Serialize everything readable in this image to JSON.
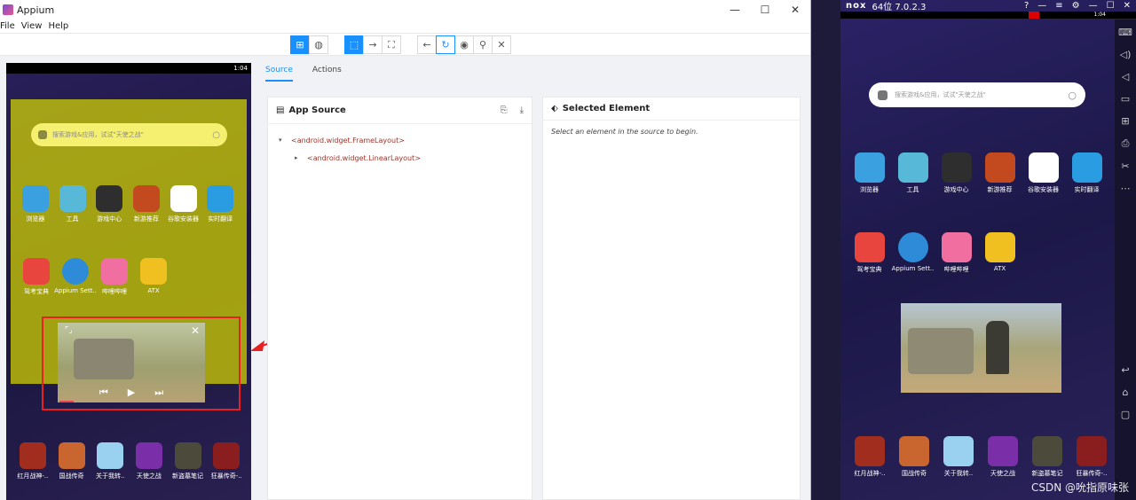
{
  "appium": {
    "title": "Appium",
    "menu": [
      "File",
      "View",
      "Help"
    ],
    "window_controls": [
      "—",
      "☐",
      "✕"
    ],
    "toolbar": {
      "view_group": [
        {
          "icon": "grid-icon",
          "glyph": "⊞"
        },
        {
          "icon": "globe-icon",
          "glyph": "◍"
        }
      ],
      "mode_group": [
        {
          "icon": "select-icon",
          "glyph": "⬚"
        },
        {
          "icon": "swipe-icon",
          "glyph": "→"
        },
        {
          "icon": "tap-area-icon",
          "glyph": "⛶"
        }
      ],
      "nav_group": [
        {
          "icon": "back-icon",
          "glyph": "←"
        },
        {
          "icon": "refresh-icon",
          "glyph": "↻"
        },
        {
          "icon": "eye-icon",
          "glyph": "◉"
        },
        {
          "icon": "search-icon",
          "glyph": "⚲"
        },
        {
          "icon": "close-icon",
          "glyph": "✕"
        }
      ]
    },
    "tabs": [
      "Source",
      "Actions"
    ],
    "app_source": {
      "title": "App Source",
      "nodes": [
        {
          "caret": "▾",
          "label": "<android.widget.FrameLayout>"
        },
        {
          "caret": "▸",
          "label": "<android.widget.LinearLayout>"
        }
      ]
    },
    "selected_element": {
      "title": "Selected Element",
      "message": "Select an element in the source to begin."
    },
    "phone": {
      "time": "1:04",
      "search_placeholder": "搜索游戏&应用，试试\"天使之战\"",
      "apps_row1": [
        {
          "label": "浏览器",
          "color": "#3aa0e0"
        },
        {
          "label": "工具",
          "color": "#58b8d8"
        },
        {
          "label": "游戏中心",
          "color": "#2e2e2e"
        },
        {
          "label": "新游推荐",
          "color": "#c24a1e"
        },
        {
          "label": "谷歌安装器",
          "color": "#ffffff"
        },
        {
          "label": "实时翻译",
          "color": "#2a9de2"
        }
      ],
      "apps_row2": [
        {
          "label": "驾考宝典",
          "color": "#e9453f"
        },
        {
          "label": "Appium Sett..",
          "color": "#2e8bd8"
        },
        {
          "label": "哔哩哔哩",
          "color": "#f06fa0"
        },
        {
          "label": "ATX",
          "color": "#f0c020"
        }
      ],
      "dock": [
        {
          "label": "红月战神-..",
          "color": "#a02d1e"
        },
        {
          "label": "国战传奇",
          "color": "#c9652e"
        },
        {
          "label": "关于我转..",
          "color": "#9ad0f0"
        },
        {
          "label": "天使之战",
          "color": "#7a2ea8"
        },
        {
          "label": "新盗墓笔记",
          "color": "#4c4a3a"
        },
        {
          "label": "狂暴传奇-..",
          "color": "#8a1e1e"
        }
      ]
    }
  },
  "nox": {
    "title": "64位 7.0.2.3",
    "logo": "nox",
    "window_controls": [
      "?",
      "—",
      "≡",
      "⚙",
      "—",
      "☐",
      "✕"
    ],
    "time": "1:04",
    "search_placeholder": "搜索游戏&应用，试试\"天使之战\"",
    "apps_row1": [
      {
        "label": "浏览器",
        "color": "#3aa0e0"
      },
      {
        "label": "工具",
        "color": "#58b8d8"
      },
      {
        "label": "游戏中心",
        "color": "#2e2e2e"
      },
      {
        "label": "新游推荐",
        "color": "#c24a1e"
      },
      {
        "label": "谷歌安装器",
        "color": "#ffffff"
      },
      {
        "label": "实时翻译",
        "color": "#2a9de2"
      }
    ],
    "apps_row2": [
      {
        "label": "驾考宝典",
        "color": "#e9453f"
      },
      {
        "label": "Appium Sett..",
        "color": "#2e8bd8"
      },
      {
        "label": "哔哩哔哩",
        "color": "#f06fa0"
      },
      {
        "label": "ATX",
        "color": "#f0c020"
      }
    ],
    "dock": [
      {
        "label": "红月战神-..",
        "color": "#a02d1e"
      },
      {
        "label": "国战传奇",
        "color": "#c9652e"
      },
      {
        "label": "关于我转..",
        "color": "#9ad0f0"
      },
      {
        "label": "天使之战",
        "color": "#7a2ea8"
      },
      {
        "label": "新盗墓笔记",
        "color": "#4c4a3a"
      },
      {
        "label": "狂暴传奇-..",
        "color": "#8a1e1e"
      }
    ],
    "sidebar_icons": [
      {
        "icon": "keyboard-icon",
        "glyph": "⌨"
      },
      {
        "icon": "volume-up-icon",
        "glyph": "◁)"
      },
      {
        "icon": "volume-down-icon",
        "glyph": "◁"
      },
      {
        "icon": "screen-icon",
        "glyph": "▭"
      },
      {
        "icon": "add-apk-icon",
        "glyph": "⊞"
      },
      {
        "icon": "print-icon",
        "glyph": "⎙"
      },
      {
        "icon": "scissors-icon",
        "glyph": "✂"
      },
      {
        "icon": "more-icon",
        "glyph": "⋯"
      },
      {
        "icon": "back-icon",
        "glyph": "↩"
      },
      {
        "icon": "home-icon",
        "glyph": "⌂"
      },
      {
        "icon": "recent-icon",
        "glyph": "▢"
      }
    ]
  },
  "watermark": "CSDN @吮指原味张"
}
